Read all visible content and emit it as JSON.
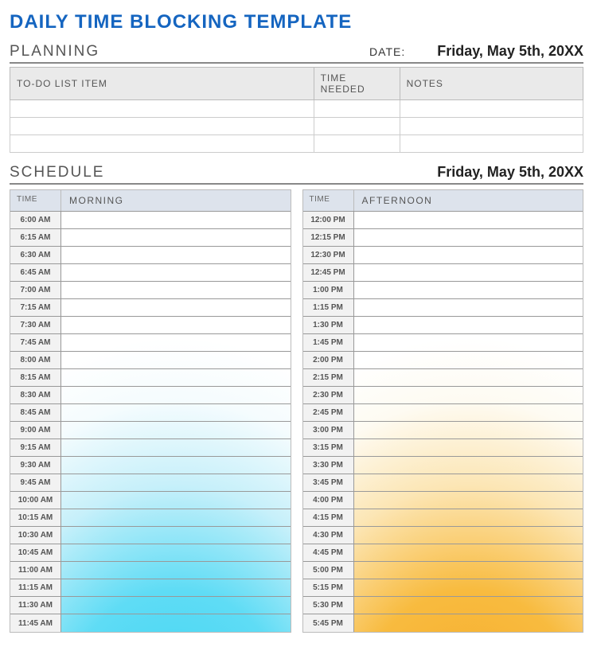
{
  "title": "DAILY TIME BLOCKING TEMPLATE",
  "planning": {
    "heading": "PLANNING",
    "date_label": "DATE:",
    "date_value": "Friday, May 5th, 20XX",
    "headers": {
      "item": "TO-DO LIST ITEM",
      "time": "TIME NEEDED",
      "notes": "NOTES"
    },
    "rows": [
      {
        "item": "",
        "time": "",
        "notes": ""
      },
      {
        "item": "",
        "time": "",
        "notes": ""
      },
      {
        "item": "",
        "time": "",
        "notes": ""
      }
    ]
  },
  "schedule": {
    "heading": "SCHEDULE",
    "date_value": "Friday, May 5th, 20XX",
    "time_header": "TIME",
    "morning": {
      "label": "MORNING",
      "slots": [
        "6:00 AM",
        "6:15 AM",
        "6:30 AM",
        "6:45 AM",
        "7:00 AM",
        "7:15 AM",
        "7:30 AM",
        "7:45 AM",
        "8:00 AM",
        "8:15 AM",
        "8:30 AM",
        "8:45 AM",
        "9:00 AM",
        "9:15 AM",
        "9:30 AM",
        "9:45 AM",
        "10:00 AM",
        "10:15 AM",
        "10:30 AM",
        "10:45 AM",
        "11:00 AM",
        "11:15 AM",
        "11:30 AM",
        "11:45 AM"
      ]
    },
    "afternoon": {
      "label": "AFTERNOON",
      "slots": [
        "12:00 PM",
        "12:15 PM",
        "12:30 PM",
        "12:45 PM",
        "1:00 PM",
        "1:15 PM",
        "1:30 PM",
        "1:45 PM",
        "2:00 PM",
        "2:15 PM",
        "2:30 PM",
        "2:45 PM",
        "3:00 PM",
        "3:15 PM",
        "3:30 PM",
        "3:45 PM",
        "4:00 PM",
        "4:15 PM",
        "4:30 PM",
        "4:45 PM",
        "5:00 PM",
        "5:15 PM",
        "5:30 PM",
        "5:45 PM"
      ]
    }
  }
}
